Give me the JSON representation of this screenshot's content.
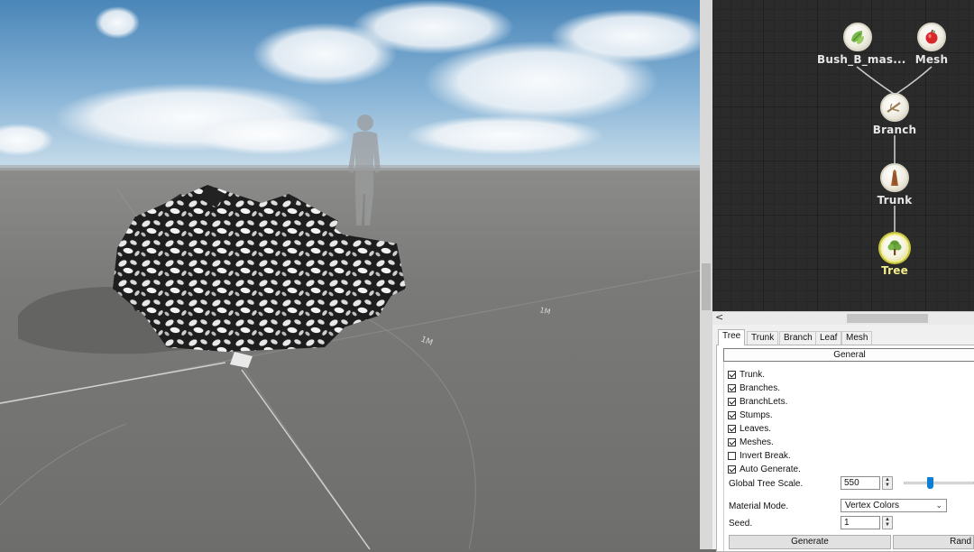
{
  "viewport": {
    "ground_labels": [
      "1M",
      "1M"
    ]
  },
  "graph": {
    "nodes": [
      {
        "label": "Bush_B_mas...",
        "icon": "leaf-icon"
      },
      {
        "label": "Mesh",
        "icon": "apple-icon"
      },
      {
        "label": "Branch",
        "icon": "branch-icon"
      },
      {
        "label": "Trunk",
        "icon": "trunk-icon"
      },
      {
        "label": "Tree",
        "icon": "tree-icon",
        "selected": true
      }
    ]
  },
  "hscroll": {
    "left_arrow": "<"
  },
  "inspector": {
    "tabs": [
      "Tree",
      "Trunk",
      "Branch",
      "Leaf",
      "Mesh"
    ],
    "active_tab": "Tree",
    "group_title": "General",
    "checkboxes": [
      {
        "label": "Trunk.",
        "checked": true
      },
      {
        "label": "Branches.",
        "checked": true
      },
      {
        "label": "BranchLets.",
        "checked": true
      },
      {
        "label": "Stumps.",
        "checked": true
      },
      {
        "label": "Leaves.",
        "checked": true
      },
      {
        "label": "Meshes.",
        "checked": true
      },
      {
        "label": "Invert Break.",
        "checked": false
      },
      {
        "label": "Auto Generate.",
        "checked": true
      }
    ],
    "global_tree_scale": {
      "label": "Global Tree Scale.",
      "value": "550",
      "slider_fraction": 0.36
    },
    "material_mode": {
      "label": "Material Mode.",
      "value": "Vertex Colors"
    },
    "seed": {
      "label": "Seed.",
      "value": "1"
    },
    "buttons": {
      "generate": "Generate",
      "random": "Rand"
    }
  },
  "colors": {
    "graph_bg": "#2b2b2b",
    "selected_node": "#f3ef8c",
    "slider_thumb": "#0a7fd8"
  }
}
